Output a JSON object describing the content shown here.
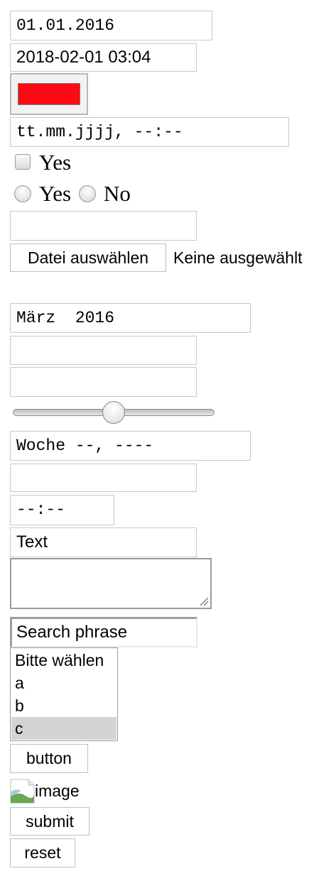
{
  "date_input": {
    "value": "01.01.2016"
  },
  "datetime_text_input": {
    "value": "2018-02-01 03:04"
  },
  "color_input": {
    "value": "#ff0a14"
  },
  "datetime_local_input": {
    "placeholder": "tt.mm.jjjj, --:--"
  },
  "checkbox": {
    "label": "Yes",
    "checked": false
  },
  "radios": [
    {
      "label": "Yes"
    },
    {
      "label": "No"
    }
  ],
  "email_input": {
    "value": ""
  },
  "file_input": {
    "button_label": "Datei auswählen",
    "status": "Keine ausgewählt"
  },
  "month_input": {
    "value": "März  2016"
  },
  "number_input": {
    "value": ""
  },
  "password_input": {
    "value": ""
  },
  "range_input": {
    "value": 50,
    "min": 0,
    "max": 100
  },
  "week_input": {
    "placeholder": "Woche --, ----"
  },
  "tel_input": {
    "value": ""
  },
  "time_input": {
    "placeholder": "--:--"
  },
  "text_input": {
    "value": "Text"
  },
  "textarea": {
    "value": ""
  },
  "search_input": {
    "value": "Search phrase"
  },
  "select": {
    "options": [
      "Bitte wählen",
      "a",
      "b",
      "c"
    ],
    "selected": "c"
  },
  "button": {
    "label": "button"
  },
  "image_input": {
    "alt": "image"
  },
  "submit_button": {
    "label": "submit"
  },
  "reset_button": {
    "label": "reset"
  }
}
